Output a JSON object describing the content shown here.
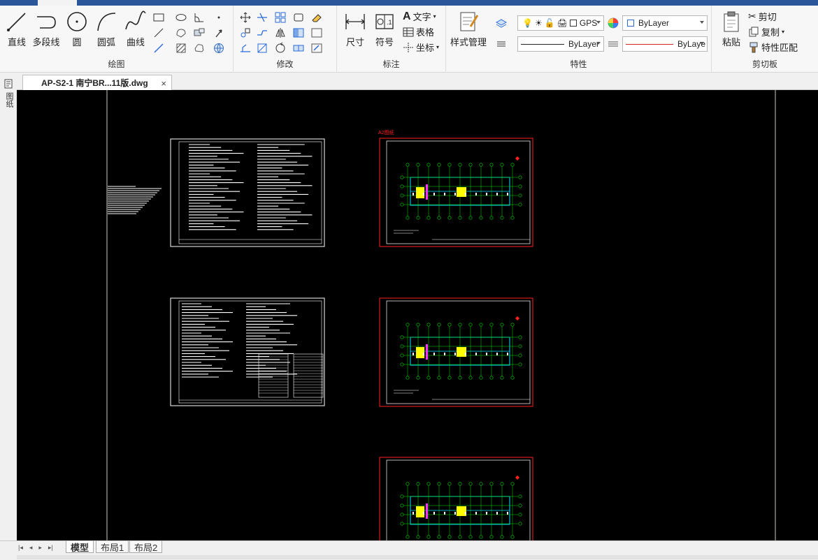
{
  "ribbon": {
    "draw": {
      "group_label": "绘图",
      "line": "直线",
      "polyline": "多段线",
      "circle": "圆",
      "arc": "圆弧",
      "curve": "曲线"
    },
    "modify": {
      "group_label": "修改"
    },
    "annotate": {
      "group_label": "标注",
      "dimension": "尺寸",
      "symbol": "符号",
      "text": "文字",
      "table": "表格",
      "coordinate": "坐标"
    },
    "properties": {
      "group_label": "特性",
      "style_manager": "样式管理",
      "layer_value": "GPS",
      "color_value": "ByLayer",
      "linetype_value": "ByLayer",
      "lineweight_value": "ByLaye"
    },
    "clipboard": {
      "group_label": "剪切板",
      "paste": "粘贴",
      "cut": "剪切",
      "copy": "复制",
      "match_props": "特性匹配"
    }
  },
  "document": {
    "tab_title": "AP-S2-1 南宁BR...11版.dwg",
    "close": "×"
  },
  "left_strip": {
    "label": "图纸"
  },
  "canvas": {
    "sheet_label": "A2图纸"
  },
  "layout_tabs": [
    "模型",
    "布局1",
    "布局2"
  ],
  "nav_arrows": [
    "|◂",
    "◂",
    "▸",
    "▸|"
  ],
  "colors": {
    "ribbon_accent": "#2b579a",
    "canvas_bg": "#000000",
    "drawing_white": "#ffffff",
    "drawing_red": "#ff2020",
    "drawing_green": "#00e000",
    "drawing_cyan": "#00e0ff",
    "drawing_yellow": "#ffff00",
    "color_line": "#cc2222"
  }
}
